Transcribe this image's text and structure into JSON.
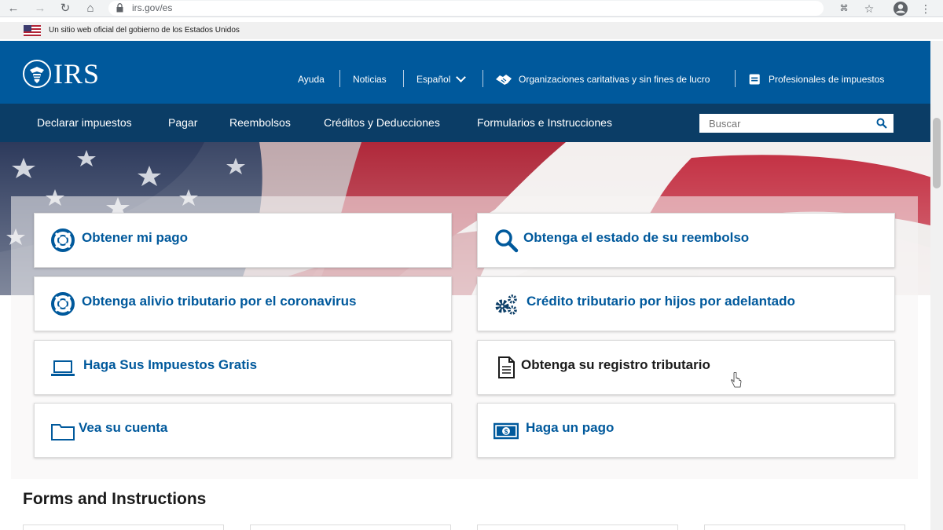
{
  "browser": {
    "url": "irs.gov/es"
  },
  "gov_banner": {
    "text": "Un sitio web oficial del gobierno de los Estados Unidos"
  },
  "header": {
    "logo_text": "IRS",
    "utility_links": [
      {
        "label": "Ayuda"
      },
      {
        "label": "Noticias"
      },
      {
        "label": "Español"
      },
      {
        "label": "Organizaciones caritativas y sin fines de lucro",
        "icon": "handshake-icon"
      },
      {
        "label": "Profesionales de impuestos",
        "icon": "briefcase-icon"
      }
    ]
  },
  "mainnav": {
    "items": [
      {
        "label": "Declarar impuestos"
      },
      {
        "label": "Pagar"
      },
      {
        "label": "Reembolsos"
      },
      {
        "label": "Créditos y Deducciones"
      },
      {
        "label": "Formularios e Instrucciones"
      }
    ],
    "search_placeholder": "Buscar"
  },
  "cards": [
    {
      "label": "Obtener mi pago",
      "icon": "lifebuoy-icon"
    },
    {
      "label": "Obtenga el estado de su reembolso",
      "icon": "magnifier-icon"
    },
    {
      "label": "Obtenga alivio tributario por el coronavirus",
      "icon": "lifebuoy-icon"
    },
    {
      "label": "Crédito tributario por hijos por adelantado",
      "icon": "gears-icon"
    },
    {
      "label": "Haga Sus Impuestos Gratis",
      "icon": "laptop-icon"
    },
    {
      "label": "Obtenga su registro tributario",
      "icon": "document-icon"
    },
    {
      "label": "Vea su cuenta",
      "icon": "folder-icon"
    },
    {
      "label": "Haga un pago",
      "icon": "money-icon"
    }
  ],
  "forms_section": {
    "title": "Forms and Instructions"
  },
  "colors": {
    "header_blue": "#00599c",
    "nav_dark_blue": "#0b3d66",
    "link_blue": "#00599c"
  }
}
